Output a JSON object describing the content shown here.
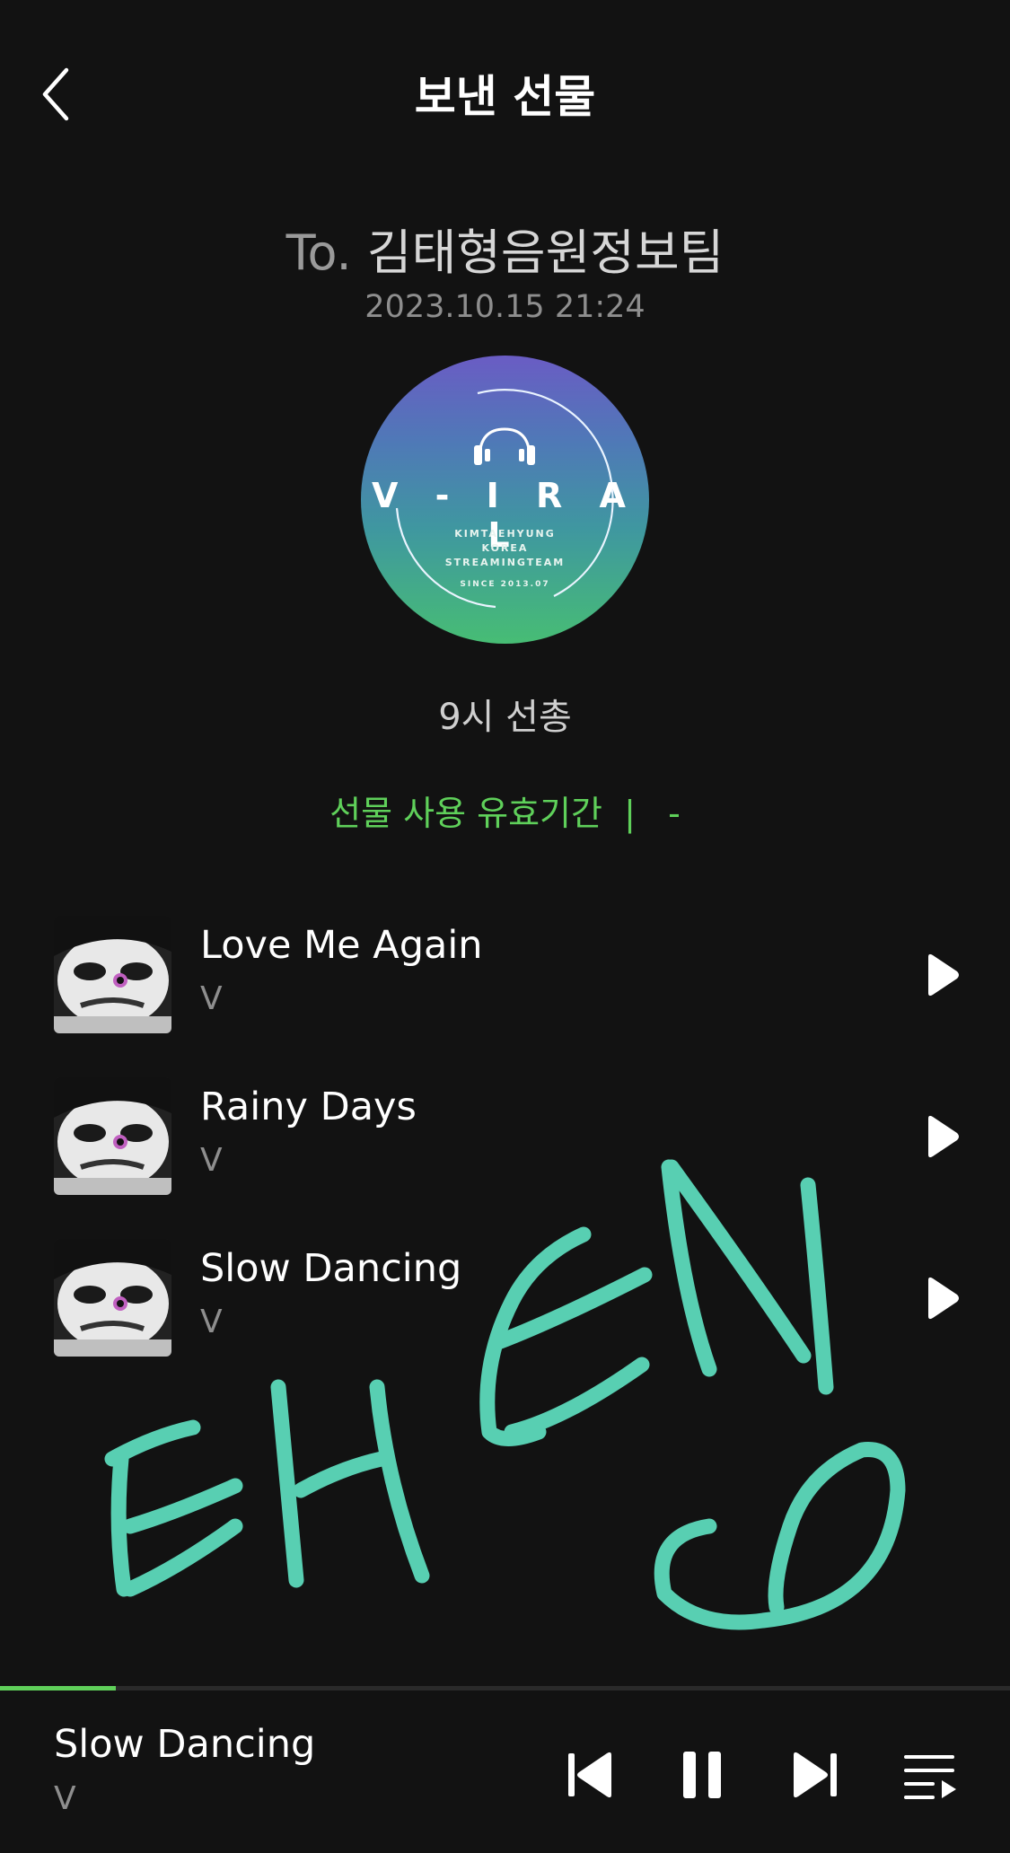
{
  "header": {
    "title": "보낸 선물",
    "back_icon": "chevron-left-icon"
  },
  "gift": {
    "to_prefix": "To.",
    "recipient": "김태형음원정보팀",
    "date": "2023.10.15 21:24",
    "logo": {
      "main": "V - I R A L",
      "line1": "KIMTAEHYUNG",
      "line2": "KOREA",
      "line3": "STREAMINGTEAM",
      "since": "SINCE 2013.07"
    },
    "message": "9시 선총",
    "validity": "선물 사용 유효기간  |   -"
  },
  "tracks": [
    {
      "title": "Love Me Again",
      "artist": "V"
    },
    {
      "title": "Rainy Days",
      "artist": "V"
    },
    {
      "title": "Slow Dancing",
      "artist": "V"
    }
  ],
  "now_playing": {
    "title": "Slow Dancing",
    "artist": "V",
    "progress": 0.115
  },
  "colors": {
    "accent": "#5fd05a",
    "background": "#121212",
    "drawing": "#5ee0c0"
  }
}
